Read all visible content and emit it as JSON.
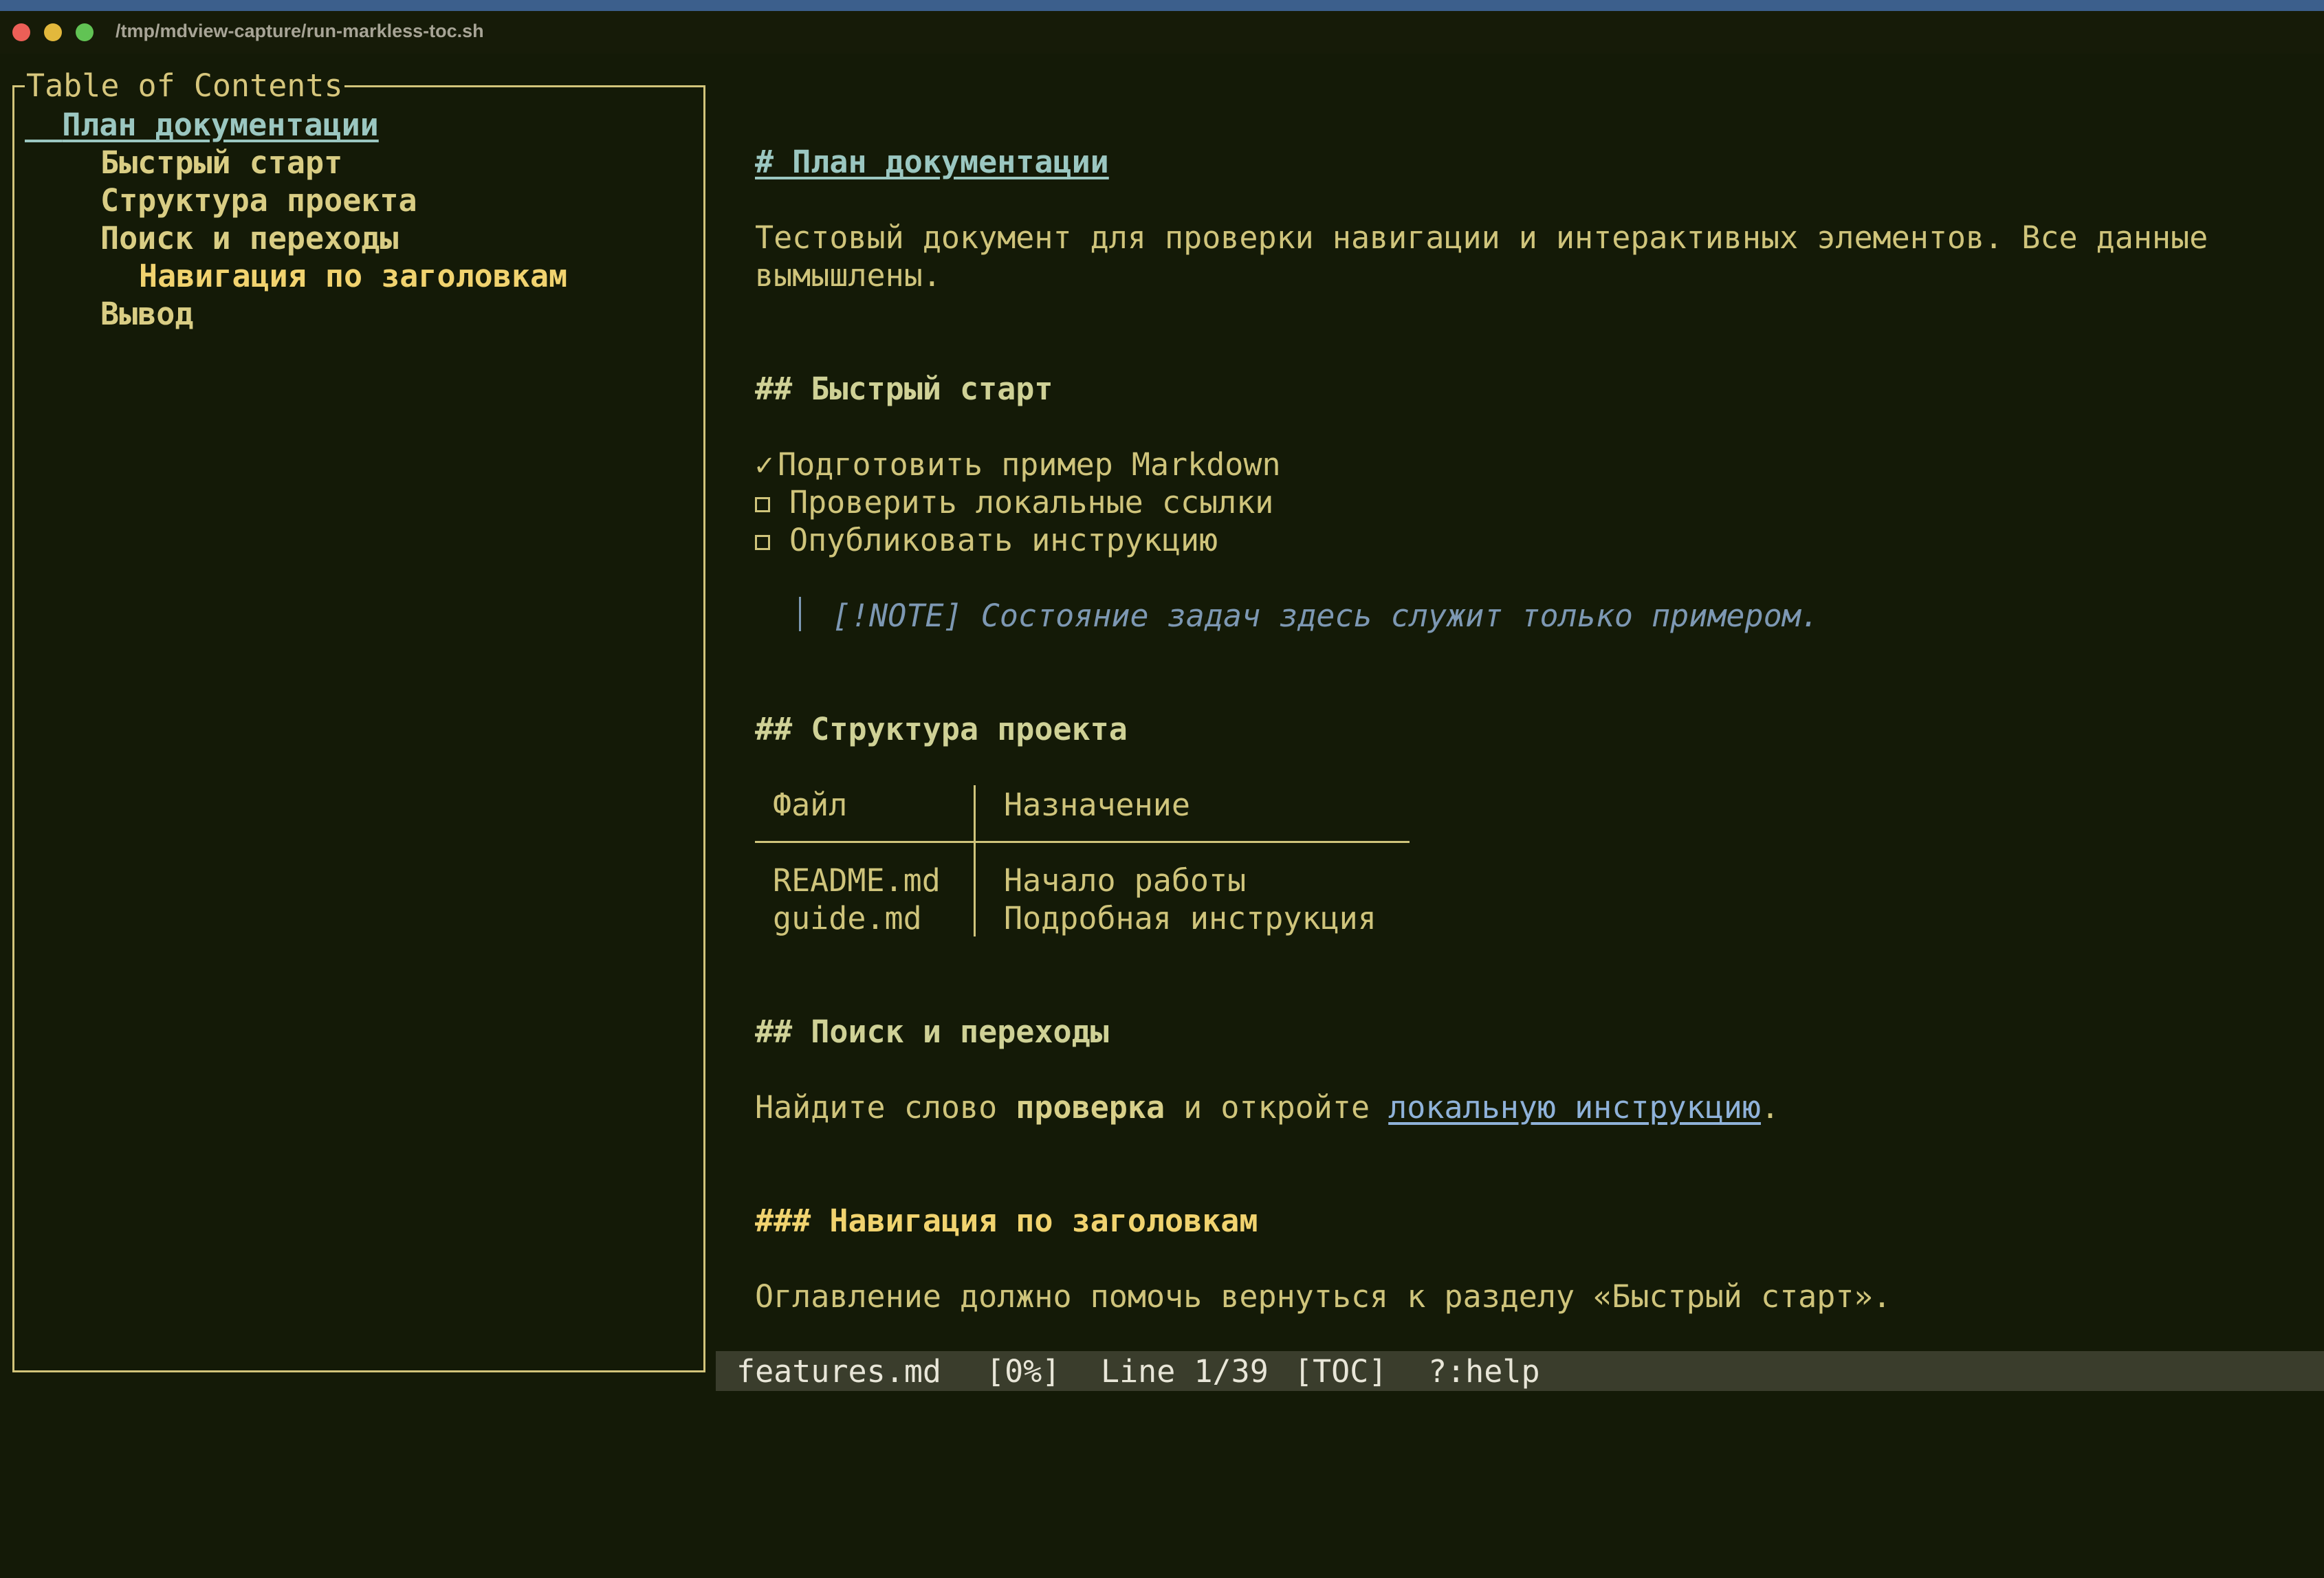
{
  "window": {
    "title": "/tmp/mdview-capture/run-markless-toc.sh"
  },
  "toc": {
    "title": "Table of Contents",
    "items": [
      {
        "label": "План документации",
        "level": 1,
        "active": true
      },
      {
        "label": "Быстрый старт",
        "level": 2
      },
      {
        "label": "Структура проекта",
        "level": 2
      },
      {
        "label": "Поиск и переходы",
        "level": 2
      },
      {
        "label": "Навигация по заголовкам",
        "level": 3
      },
      {
        "label": "Вывод",
        "level": 2
      }
    ]
  },
  "doc": {
    "h1": "# План документации",
    "intro_line1": "Тестовый документ для проверки навигации и интерактивных элементов. Все данные",
    "intro_line2": "вымышлены.",
    "h2_quickstart": "## Быстрый старт",
    "tasks": [
      {
        "label": "Подготовить пример Markdown",
        "done": true,
        "mark": "✓"
      },
      {
        "label": "Проверить локальные ссылки",
        "done": false
      },
      {
        "label": "Опубликовать инструкцию",
        "done": false
      }
    ],
    "note": "[!NOTE] Состояние задач здесь служит только примером.",
    "h2_structure": "## Структура проекта",
    "table": {
      "headers": [
        "Файл",
        "Назначение"
      ],
      "rows": [
        [
          "README.md",
          "Начало работы"
        ],
        [
          "guide.md",
          "Подробная инструкция"
        ]
      ]
    },
    "h2_search": "## Поиск и переходы",
    "search_prefix": "Найдите слово ",
    "search_bold": "проверка",
    "search_mid": " и откройте ",
    "search_link": "локальную инструкцию",
    "search_suffix": ".",
    "h3_nav": "### Навигация по заголовкам",
    "nav_text": "Оглавление должно помочь вернуться к разделу «Быстрый старт»."
  },
  "status": {
    "file": "features.md",
    "percent": "[0%]",
    "line": "Line 1/39",
    "mode": "[TOC]",
    "help": "?:help"
  }
}
